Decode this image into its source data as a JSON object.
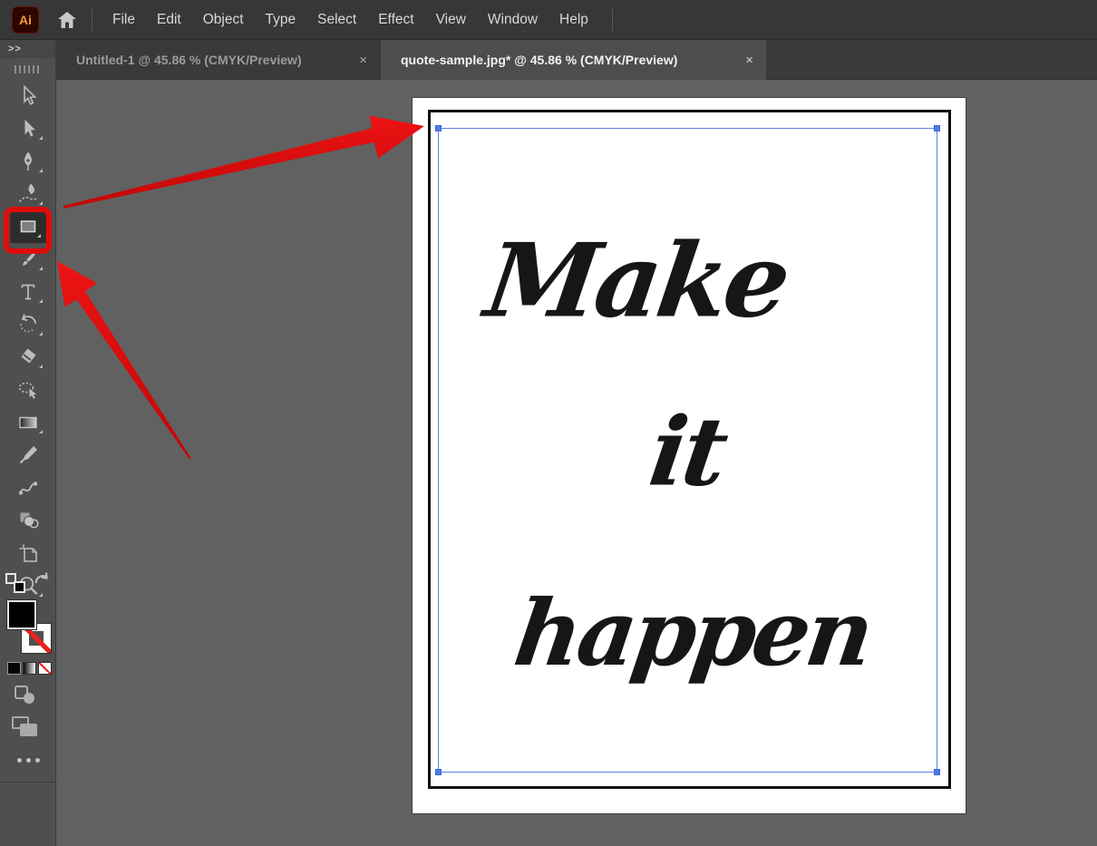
{
  "menubar": {
    "app_icon": "Ai",
    "items": [
      "File",
      "Edit",
      "Object",
      "Type",
      "Select",
      "Effect",
      "View",
      "Window",
      "Help"
    ]
  },
  "tabs": [
    {
      "title": "Untitled-1 @ 45.86 % (CMYK/Preview)",
      "active": false
    },
    {
      "title": "quote-sample.jpg* @ 45.86 % (CMYK/Preview)",
      "active": true
    }
  ],
  "ui": {
    "close_glyph": "×",
    "expand_glyph": ">>"
  },
  "toolbar": {
    "tools": [
      "selection",
      "direct-selection",
      "pen",
      "curvature",
      "rectangle",
      "paintbrush",
      "type",
      "rotate",
      "eraser",
      "lasso",
      "gradient",
      "eyedropper",
      "blend",
      "shape-builder",
      "artboard",
      "zoom"
    ],
    "selected_tool": "rectangle",
    "fill_color": "#000000",
    "stroke_style": "none"
  },
  "artwork": {
    "lines": [
      "Make",
      "it",
      "happen"
    ]
  },
  "annotations": {
    "highlight_target": "rectangle-tool",
    "arrow_targets": [
      "rectangle-tool",
      "selection-top-left-corner"
    ]
  },
  "colors": {
    "annotation_red": "#d90d0d",
    "selection_blue": "#4f7ce8",
    "pasteboard_gray": "#616161",
    "panel_gray": "#4f4f4f",
    "menubar_gray": "#373737"
  }
}
